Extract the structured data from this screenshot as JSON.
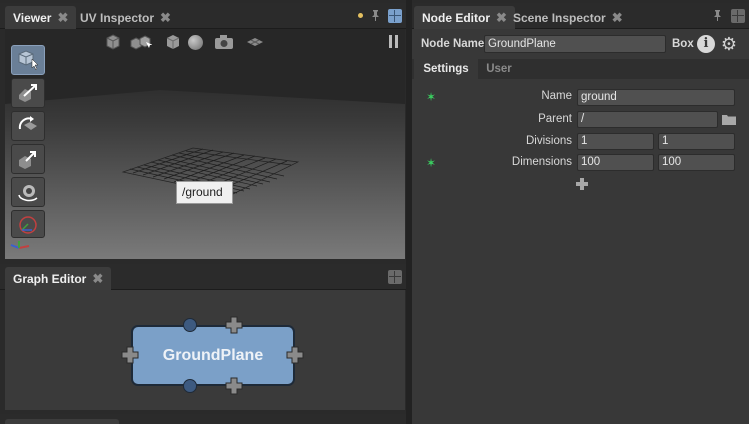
{
  "viewer_tabs": [
    {
      "label": "Viewer",
      "active": true
    },
    {
      "label": "UV Inspector",
      "active": false
    }
  ],
  "graph_tabs": [
    {
      "label": "Graph Editor",
      "active": true
    }
  ],
  "node_editor_tabs": [
    {
      "label": "Node Editor",
      "active": true
    },
    {
      "label": "Scene Inspector",
      "active": false
    }
  ],
  "viewer": {
    "tooltip": "/ground",
    "toolbar_icons": [
      "cube-icon",
      "cubes-icon",
      "box-icon",
      "sphere-icon",
      "camera-icon",
      "grid-plane-icon"
    ],
    "left_tools": [
      "select-tool",
      "translate-tool",
      "rotate-tool",
      "scale-tool",
      "camera-tool",
      "transform-tool"
    ]
  },
  "graph": {
    "node_name": "GroundPlane",
    "node_color": "#7ba0c8"
  },
  "node_editor": {
    "node_name_label": "Node Name",
    "node_name_value": "GroundPlane",
    "node_type": "Box",
    "sub_tabs": [
      "Settings",
      "User"
    ],
    "params": {
      "name_label": "Name",
      "name_value": "ground",
      "parent_label": "Parent",
      "parent_value": "/",
      "divisions_label": "Divisions",
      "divisions_x": "1",
      "divisions_y": "1",
      "dimensions_label": "Dimensions",
      "dimensions_x": "100",
      "dimensions_y": "100"
    }
  },
  "colors": {
    "accent": "#6a7f97",
    "dot": "#e4c060",
    "star": "#3ad060"
  }
}
